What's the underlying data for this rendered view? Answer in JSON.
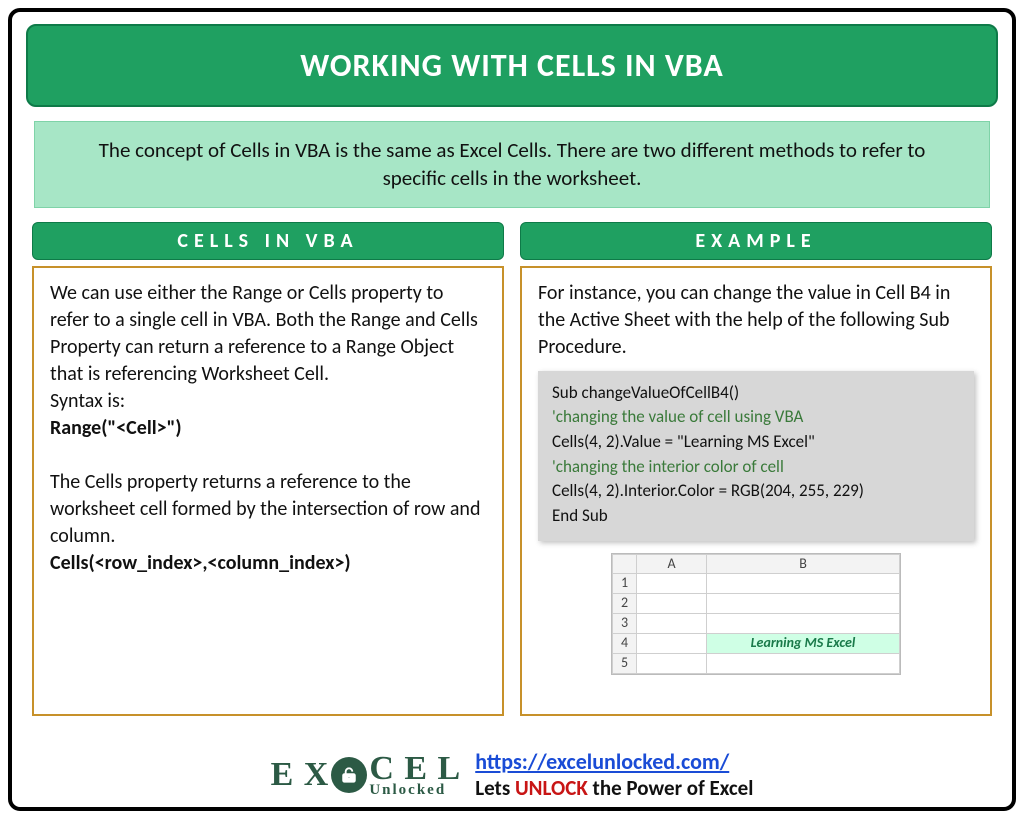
{
  "title": "WORKING WITH CELLS IN VBA",
  "description": "The concept of Cells in VBA is the same as Excel Cells. There are two different methods to refer to specific cells in the worksheet.",
  "left": {
    "header": "CELLS IN VBA",
    "para1": "We can use either the Range or Cells property to refer to a single cell in VBA. Both the Range and Cells Property can return a reference to a Range Object that is referencing Worksheet Cell.",
    "syntax_label": "Syntax is:",
    "range_syntax": "Range(\"<Cell>\")",
    "para2": "The Cells property returns a reference to the worksheet cell formed by the intersection of row and column.",
    "cells_syntax": "Cells(<row_index>,<column_index>)"
  },
  "right": {
    "header": "EXAMPLE",
    "intro": "For instance, you can change the value in Cell B4 in the Active Sheet with the help of the following Sub Procedure.",
    "code": {
      "l1": "Sub changeValueOfCellB4()",
      "l2": "'changing the value of cell using VBA",
      "l3": "Cells(4, 2).Value = \"Learning MS Excel\"",
      "l4": "'changing the interior color of cell",
      "l5": "Cells(4, 2).Interior.Color = RGB(204, 255, 229)",
      "l6": "End Sub"
    },
    "sheet": {
      "colA": "A",
      "colB": "B",
      "rows": [
        "1",
        "2",
        "3",
        "4",
        "5"
      ],
      "b4": "Learning MS Excel"
    }
  },
  "footer": {
    "logo_top": "E X C E L",
    "logo_bottom": "Unlocked",
    "url": "https://excelunlocked.com/",
    "tag_pre": "Lets ",
    "tag_word": "UNLOCK",
    "tag_post": " the Power of Excel"
  }
}
